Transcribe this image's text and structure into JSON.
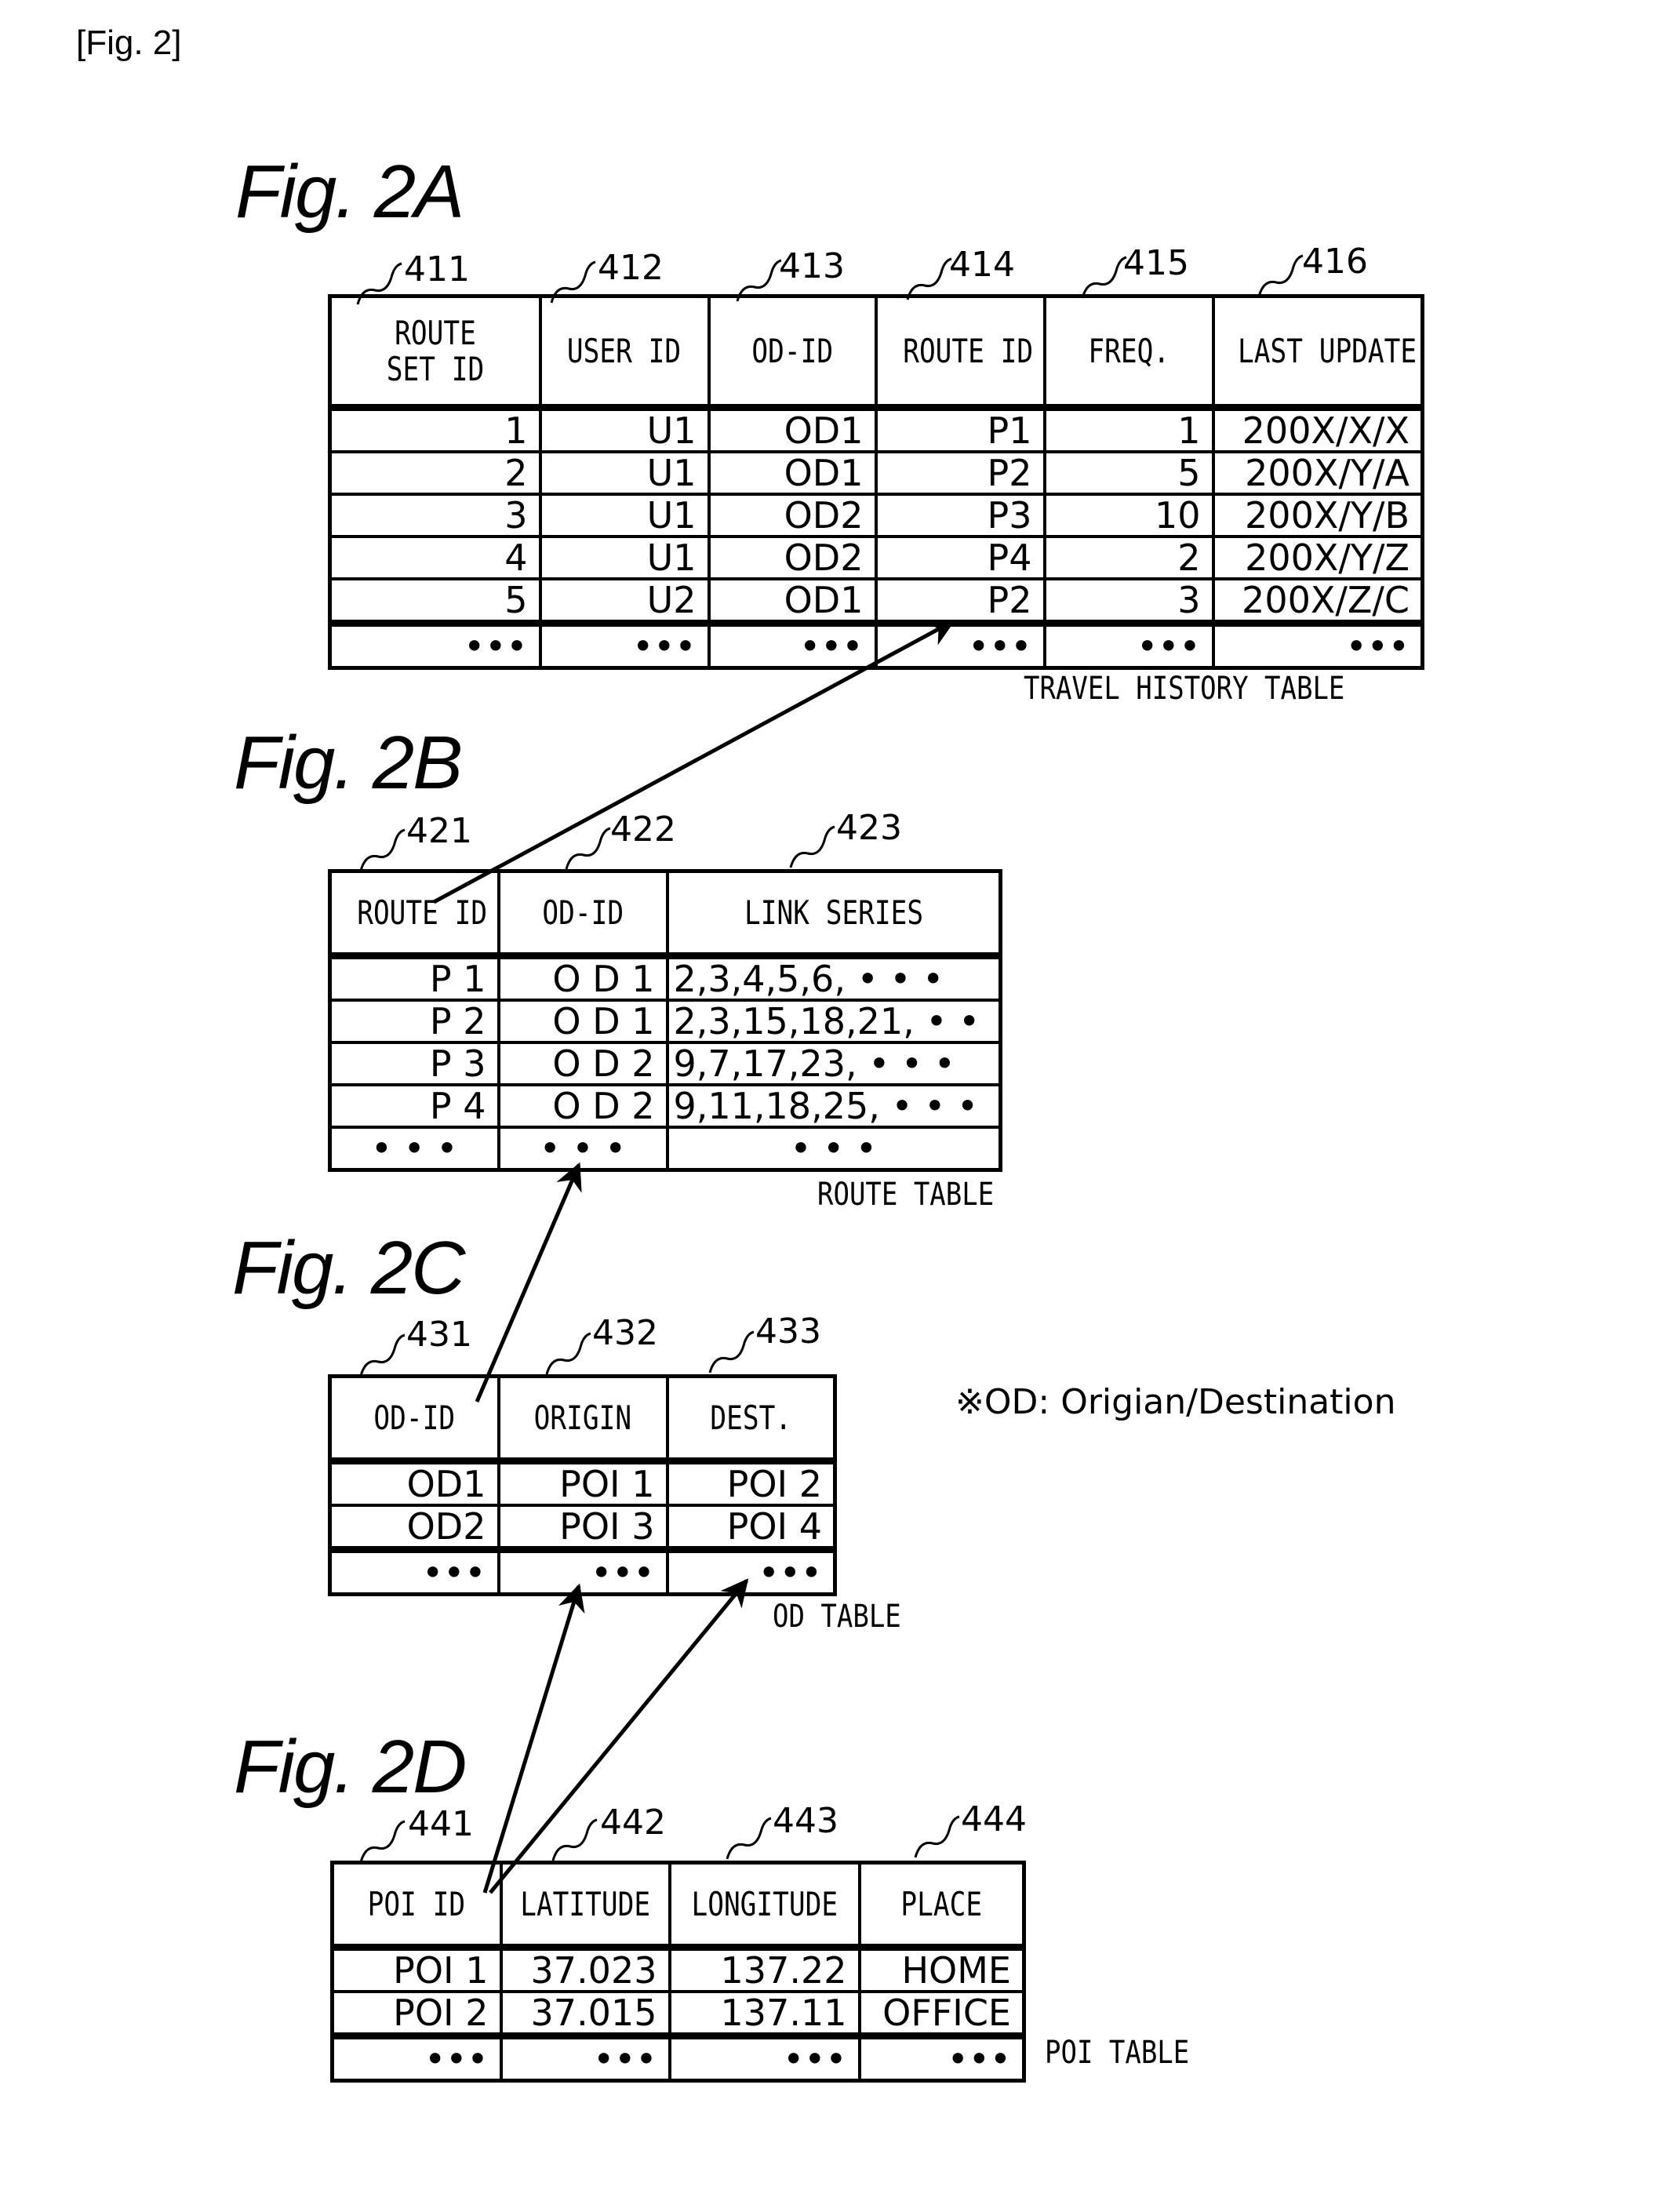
{
  "figure_title": "[Fig. 2]",
  "footnote": "※OD: Origian/Destination",
  "fig_2a": {
    "label": "Fig. 2A",
    "caption": "TRAVEL HISTORY TABLE",
    "refs": [
      "411",
      "412",
      "413",
      "414",
      "415",
      "416"
    ],
    "columns": [
      "ROUTE SET ID",
      "USER ID",
      "OD-ID",
      "ROUTE ID",
      "FREQ.",
      "LAST UPDATE"
    ],
    "rows": [
      [
        "1",
        "U1",
        "OD1",
        "P1",
        "1",
        "200X/X/X"
      ],
      [
        "2",
        "U1",
        "OD1",
        "P2",
        "5",
        "200X/Y/A"
      ],
      [
        "3",
        "U1",
        "OD2",
        "P3",
        "10",
        "200X/Y/B"
      ],
      [
        "4",
        "U1",
        "OD2",
        "P4",
        "2",
        "200X/Y/Z"
      ],
      [
        "5",
        "U2",
        "OD1",
        "P2",
        "3",
        "200X/Z/C"
      ],
      [
        "•••",
        "•••",
        "•••",
        "•••",
        "•••",
        "•••"
      ]
    ]
  },
  "fig_2b": {
    "label": "Fig. 2B",
    "caption": "ROUTE TABLE",
    "refs": [
      "421",
      "422",
      "423"
    ],
    "columns": [
      "ROUTE ID",
      "OD-ID",
      "LINK SERIES"
    ],
    "rows": [
      [
        "P 1",
        "O D 1",
        "2,3,4,5,6, • • •"
      ],
      [
        "P 2",
        "O D 1",
        "2,3,15,18,21, • •"
      ],
      [
        "P 3",
        "O D 2",
        "9,7,17,23, • • •"
      ],
      [
        "P 4",
        "O D 2",
        "9,11,18,25, • • •"
      ],
      [
        "• • •",
        "• • •",
        "• • •"
      ]
    ]
  },
  "fig_2c": {
    "label": "Fig. 2C",
    "caption": "OD TABLE",
    "refs": [
      "431",
      "432",
      "433"
    ],
    "columns": [
      "OD-ID",
      "ORIGIN",
      "DEST."
    ],
    "rows": [
      [
        "OD1",
        "POI 1",
        "POI 2"
      ],
      [
        "OD2",
        "POI 3",
        "POI 4"
      ],
      [
        "•••",
        "•••",
        "•••"
      ]
    ]
  },
  "fig_2d": {
    "label": "Fig. 2D",
    "caption": "POI TABLE",
    "refs": [
      "441",
      "442",
      "443",
      "444"
    ],
    "columns": [
      "POI ID",
      "LATITUDE",
      "LONGITUDE",
      "PLACE"
    ],
    "rows": [
      [
        "POI 1",
        "37.023",
        "137.22",
        "HOME"
      ],
      [
        "POI 2",
        "37.015",
        "137.11",
        "OFFICE"
      ],
      [
        "•••",
        "•••",
        "•••",
        "•••"
      ]
    ]
  }
}
